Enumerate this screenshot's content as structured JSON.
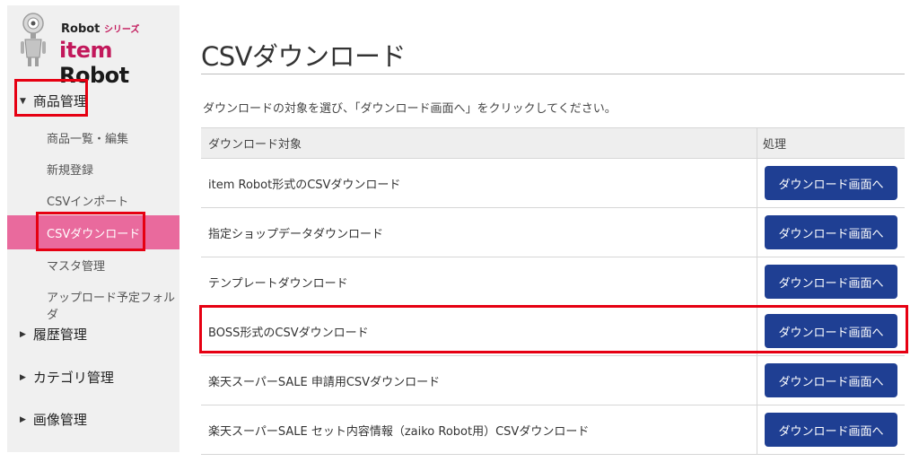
{
  "brand": {
    "series_prefix": "Robot",
    "series_suffix": "シリーズ",
    "name_item": "item",
    "name_robot": "Robot"
  },
  "sidebar": {
    "sections": [
      {
        "label": "商品管理",
        "expanded": true
      },
      {
        "label": "履歴管理",
        "expanded": false
      },
      {
        "label": "カテゴリ管理",
        "expanded": false
      },
      {
        "label": "画像管理",
        "expanded": false
      }
    ],
    "items": [
      {
        "label": "商品一覧・編集"
      },
      {
        "label": "新規登録"
      },
      {
        "label": "CSVインポート"
      },
      {
        "label": "CSVダウンロード",
        "active": true
      },
      {
        "label": "マスタ管理"
      },
      {
        "label": "アップロード予定フォルダ"
      }
    ]
  },
  "main": {
    "title": "CSVダウンロード",
    "instruction": "ダウンロードの対象を選び、「ダウンロード画面へ」をクリックしてください。",
    "table": {
      "headers": [
        "ダウンロード対象",
        "処理"
      ],
      "button_label": "ダウンロード画面へ",
      "rows": [
        {
          "target": "item Robot形式のCSVダウンロード"
        },
        {
          "target": "指定ショップデータダウンロード"
        },
        {
          "target": "テンプレートダウンロード"
        },
        {
          "target": "BOSS形式のCSVダウンロード"
        },
        {
          "target": "楽天スーパーSALE 申請用CSVダウンロード"
        },
        {
          "target": "楽天スーパーSALE セット内容情報（zaiko Robot用）CSVダウンロード"
        }
      ]
    }
  },
  "colors": {
    "active_nav": "#e96a9d",
    "button": "#1f3f93",
    "highlight": "#e60012",
    "brand_pink": "#c2185b"
  }
}
